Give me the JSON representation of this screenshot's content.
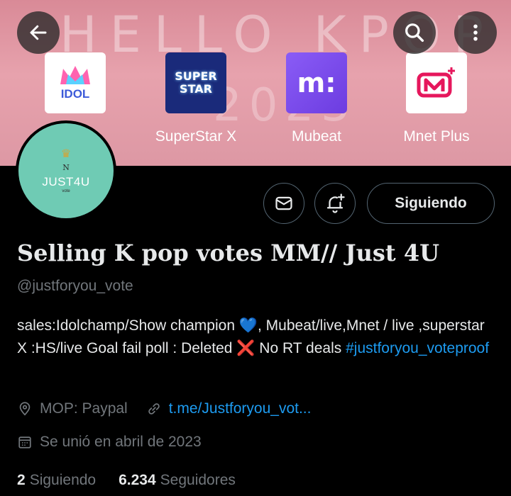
{
  "banner": {
    "headline": "HELLO KPOP",
    "year": "2023",
    "apps": [
      {
        "name": "IDOL",
        "label": "",
        "icon": "idol-crown-logo"
      },
      {
        "name": "SUPER STAR",
        "label": "SuperStar X",
        "icon": "superstar-logo"
      },
      {
        "name": "m:",
        "label": "Mubeat",
        "icon": "mubeat-logo"
      },
      {
        "name": "M+",
        "label": "Mnet Plus",
        "icon": "mnet-plus-logo"
      }
    ]
  },
  "toolbar": {
    "back_icon": "arrow-left-icon",
    "search_icon": "search-icon",
    "more_icon": "more-vertical-icon"
  },
  "avatar": {
    "initial": "N",
    "name": "JUST4U",
    "sub": "vote"
  },
  "actions": {
    "message_icon": "mail-icon",
    "notify_icon": "bell-plus-icon",
    "follow_label": "Siguiendo"
  },
  "profile": {
    "display_name": "Selling K pop votes MM// Just 4U",
    "handle": "@justforyou_vote",
    "bio_part1": "sales:Idolchamp/Show champion ",
    "bio_heart": "💙",
    "bio_part2": ", Mubeat/live,Mnet / live ,superstar X :HS/live  Goal fail poll : Deleted ",
    "bio_cross": "❌",
    "bio_part3": " No RT deals  ",
    "bio_hashtag": "#justforyou_voteproof",
    "location": "MOP: Paypal",
    "link": "t.me/Justforyou_vot...",
    "joined": "Se unió en abril de 2023"
  },
  "stats": {
    "following_count": "2",
    "following_label": "Siguiendo",
    "followers_count": "6.234",
    "followers_label": "Seguidores"
  },
  "colors": {
    "accent": "#1d9bf0",
    "muted": "#71767b",
    "avatar_bg": "#6fcbb4"
  }
}
